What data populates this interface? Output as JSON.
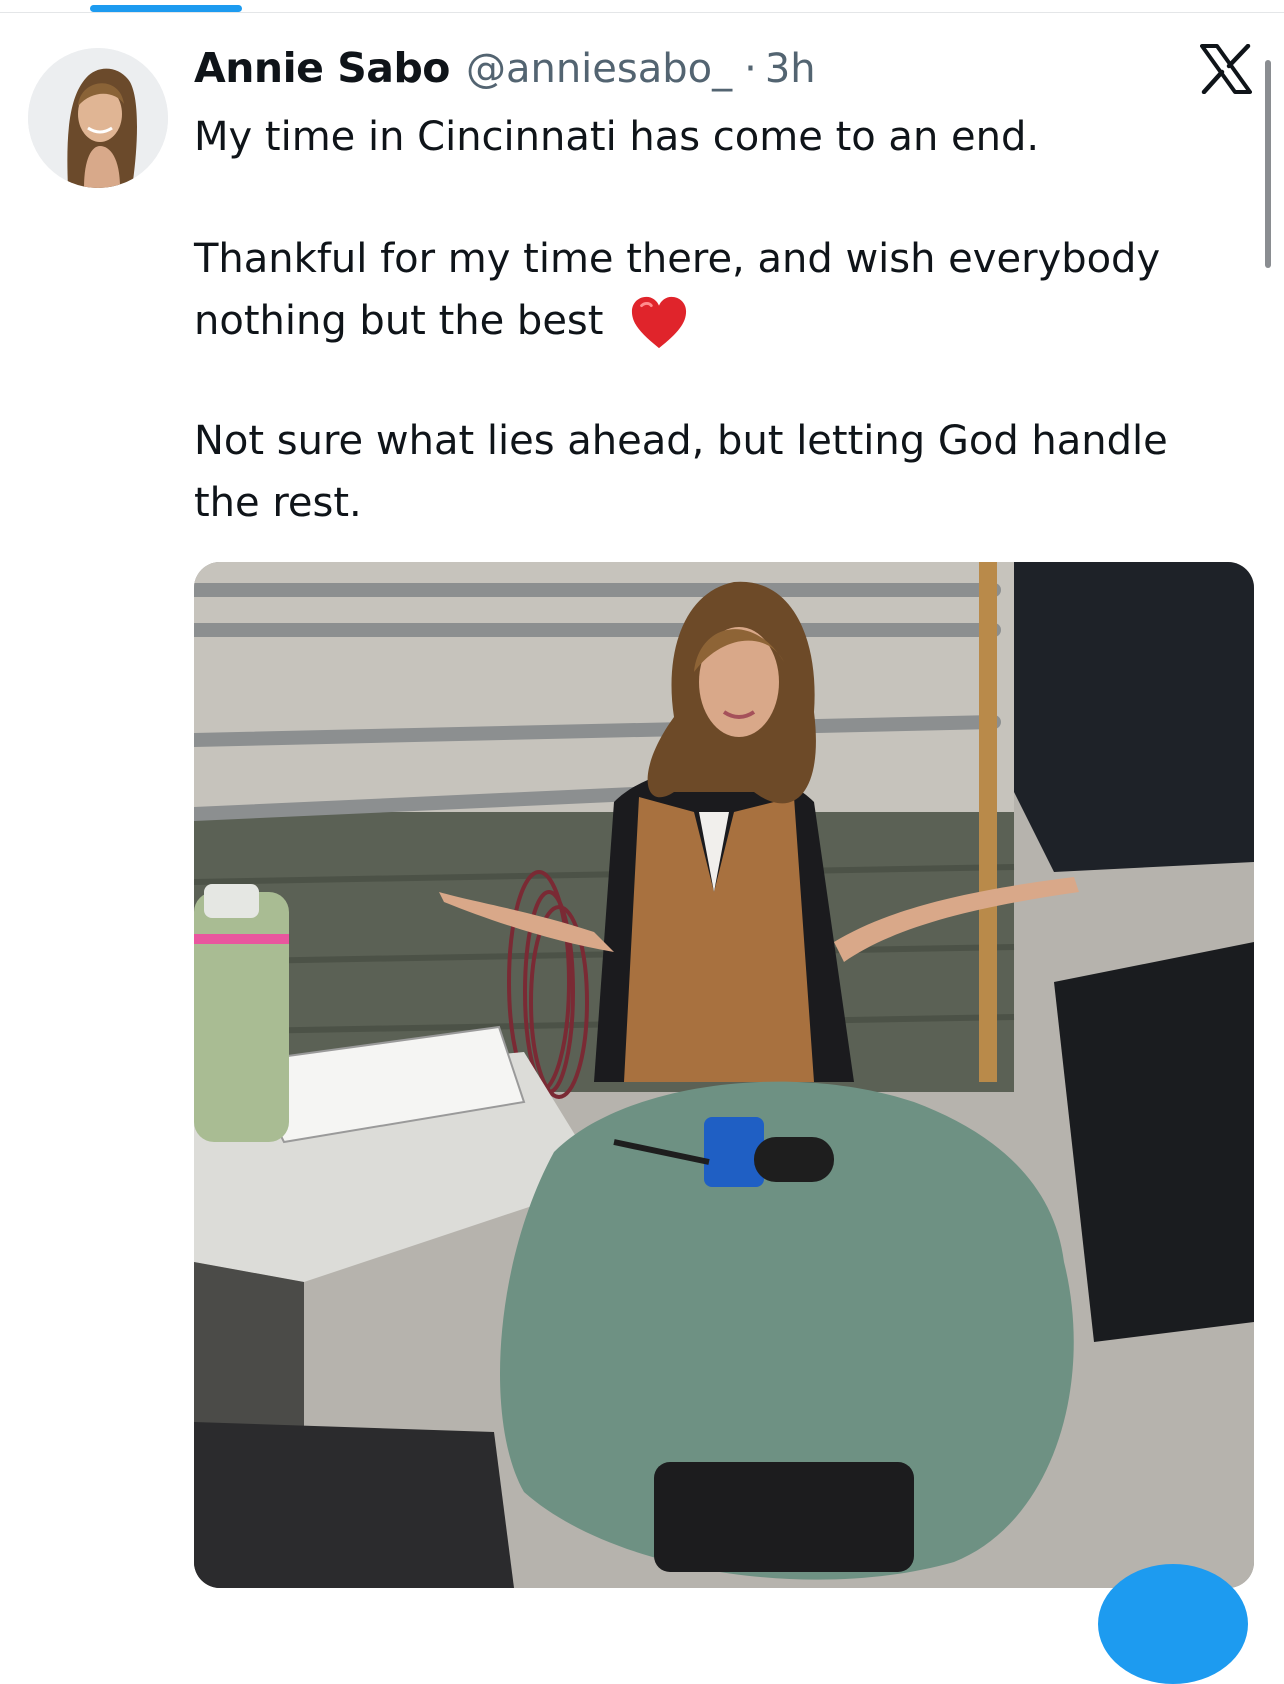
{
  "tweet": {
    "display_name": "Annie Sabo",
    "handle": "@anniesabo_",
    "separator": "·",
    "time": "3h",
    "text_line1": "My time in Cincinnati has come to an end.",
    "text_para2_line1": "Thankful for my time there, and wish everybody",
    "text_para2_line2": "nothing but the best",
    "text_para3_line1": "Not sure what lies ahead, but letting God handle",
    "text_para3_line2": "the rest."
  },
  "icons": {
    "avatar": "profile-photo",
    "platform_logo": "x-logo-icon",
    "emoji": "red-heart-icon"
  },
  "media": {
    "type": "photo"
  },
  "colors": {
    "accent": "#1d9bf0",
    "text_primary": "#0f1419",
    "text_secondary": "#536471",
    "heart": "#e0242b"
  }
}
